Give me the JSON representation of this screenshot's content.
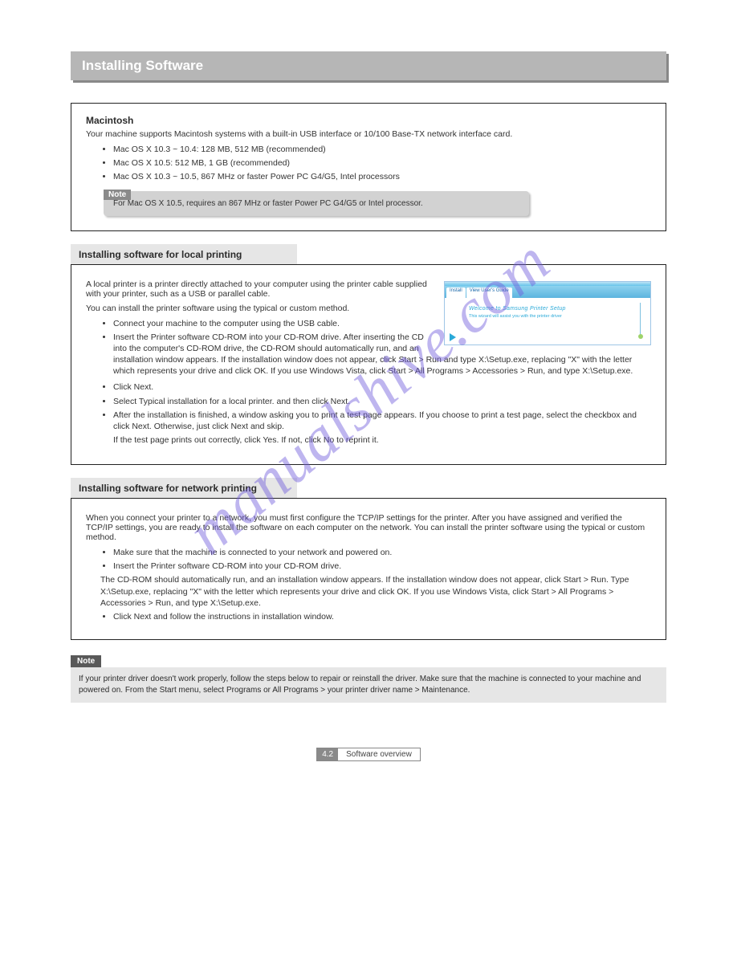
{
  "watermark": "manualshive.com",
  "title": "Installing Software",
  "macCard": {
    "heading": "Macintosh",
    "lead": "Your machine supports Macintosh systems with a built-in USB interface or 10/100 Base-TX network interface card.",
    "bullets": [
      "Mac OS X 10.3 ~ 10.4: 128 MB, 512 MB (recommended)",
      "Mac OS X 10.5: 512 MB, 1 GB (recommended)",
      "Mac OS X 10.3 ~ 10.5, 867 MHz or faster Power PC G4/G5, Intel processors"
    ],
    "note_label": "Note",
    "note_body": "For Mac OS X 10.5, requires an 867 MHz or faster Power PC G4/G5 or Intel processor."
  },
  "secA": {
    "heading": "Installing software for local printing",
    "intro": "A local printer is a printer directly attached to your computer using the printer cable supplied with your printer, such as a USB or parallel cable.",
    "p1": "You can install the printer software using the typical or custom method.",
    "bullets1": [
      "Connect your machine to the computer using the USB cable.",
      "Insert the Printer software CD-ROM into your CD-ROM drive. After inserting the CD into the computer's CD-ROM drive, the CD-ROM should automatically run, and an installation window appears. If the installation window does not appear, click Start > Run and type X:\\Setup.exe, replacing \"X\" with the letter which represents your drive and click OK. If you use Windows Vista, click Start > All Programs > Accessories > Run, and type X:\\Setup.exe.",
      "Click Next.",
      "Select Typical installation for a local printer. and then click Next.",
      "After the installation is finished, a window asking you to print a test page appears. If you choose to print a test page, select the checkbox and click Next. Otherwise, just click Next and skip."
    ],
    "p2": "If the test page prints out correctly, click Yes. If not, click No to reprint it.",
    "screenshot": {
      "tabs": [
        "Install",
        "View User's Guide"
      ],
      "title": "Welcome to Samsung Printer Setup",
      "subtitle": "This wizard will assist you with the printer driver"
    }
  },
  "secB": {
    "heading": "Installing software for network printing",
    "intro": "When you connect your printer to a network, you must first configure the TCP/IP settings for the printer. After you have assigned and verified the TCP/IP settings, you are ready to install the software on each computer on the network. You can install the printer software using the typical or custom method.",
    "bullets": [
      "Make sure that the machine is connected to your network and powered on.",
      "Insert the Printer software CD-ROM into your CD-ROM drive.",
      "The CD-ROM should automatically run, and an installation window appears. If the installation window does not appear, click Start > Run. Type X:\\Setup.exe, replacing \"X\" with the letter which represents your drive and click OK. If you use Windows Vista, click Start > All Programs > Accessories > Run, and type X:\\Setup.exe.",
      "Click Next and follow the instructions in installation window."
    ]
  },
  "finalNote": {
    "label": "Note",
    "body": "If your printer driver doesn't work properly, follow the steps below to repair or reinstall the driver. Make sure that the machine is connected to your machine and powered on. From the Start menu, select Programs or All Programs > your printer driver name > Maintenance."
  },
  "footer": {
    "page": "4.",
    "section_num": "2",
    "section_name": "Software overview"
  }
}
